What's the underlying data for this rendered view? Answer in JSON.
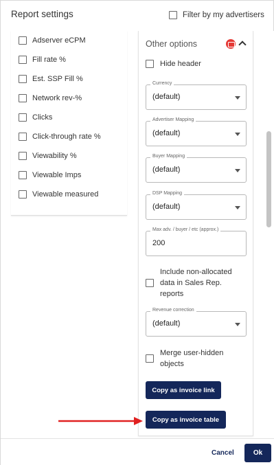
{
  "header": {
    "title": "Report settings",
    "filter_label": "Filter by my advertisers"
  },
  "metrics": [
    "Adserver eCPM",
    "Fill rate %",
    "Est. SSP Fill %",
    "Network rev-%",
    "Clicks",
    "Click-through rate %",
    "Viewability %",
    "Viewable Imps",
    "Viewable measured"
  ],
  "options": {
    "title": "Other options",
    "hide_header": "Hide header",
    "currency": {
      "label": "Currency",
      "value": "(default)"
    },
    "advertiser_mapping": {
      "label": "Advertiser Mapping",
      "value": "(default)"
    },
    "buyer_mapping": {
      "label": "Buyer Mapping",
      "value": "(default)"
    },
    "dsp_mapping": {
      "label": "DSP Mapping",
      "value": "(default)"
    },
    "max_adv": {
      "label": "Max adv. / buyer / etc (approx.)",
      "value": "200"
    },
    "include_nonallocated": "Include non-allocated data in Sales Rep. reports",
    "revenue_correction": {
      "label": "Revenue correction",
      "value": "(default)"
    },
    "merge_hidden": "Merge user-hidden objects",
    "copy_link_label": "Copy as invoice link",
    "copy_table_label": "Copy as invoice table"
  },
  "footer": {
    "cancel_label": "Cancel",
    "ok_label": "Ok"
  },
  "colors": {
    "primary": "#14275a",
    "badge": "#e53935",
    "arrow": "#e02020"
  },
  "icons": {
    "badge": "badge-icon",
    "chevron": "chevron-up-icon",
    "caret": "dropdown-caret-icon",
    "arrow": "arrow-right-icon"
  }
}
